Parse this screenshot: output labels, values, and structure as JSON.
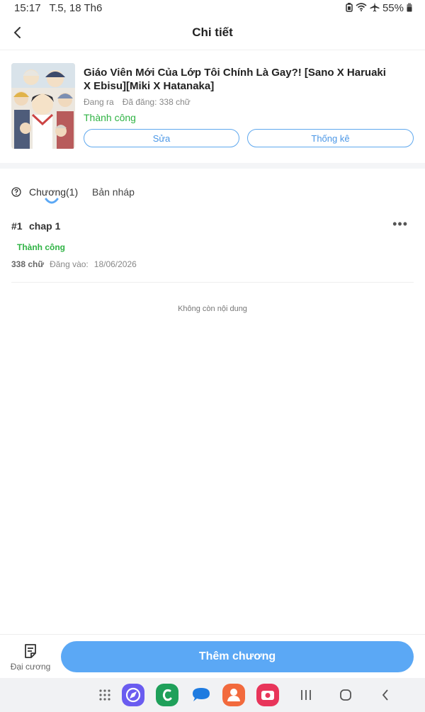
{
  "statusbar": {
    "time": "15:17",
    "date": "T.5, 18 Th6",
    "battery": "55%"
  },
  "header": {
    "title": "Chi tiết"
  },
  "novel": {
    "title": "Giáo Viên Mới Của Lớp Tôi Chính Là Gay?! [Sano X Haruaki X Ebisu][Miki X Hatanaka]",
    "state": "Đang ra",
    "posted": "Đã đăng: 338 chữ",
    "status": "Thành công",
    "edit_label": "Sửa",
    "stats_label": "Thống kê"
  },
  "tabs": {
    "chapters": "Chương(1)",
    "drafts": "Bản nháp"
  },
  "chapters": [
    {
      "number": "#1",
      "title": "chap 1",
      "status": "Thành công",
      "words": "338 chữ",
      "posted_label": "Đăng vào:",
      "date": "18/06/2026"
    }
  ],
  "empty_text": "Không còn nội dung",
  "bottom": {
    "outline_label": "Đại cương",
    "add_chapter_label": "Thêm chương"
  },
  "colors": {
    "accent": "#5ba8f5",
    "success": "#2fb344"
  }
}
